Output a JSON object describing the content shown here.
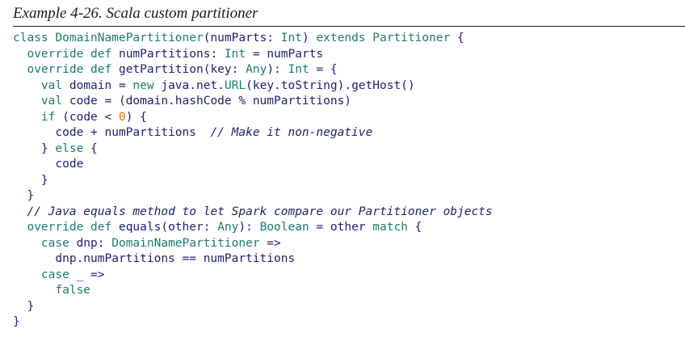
{
  "caption": "Example 4-26. Scala custom partitioner",
  "code_lines": [
    [
      [
        "k",
        "class "
      ],
      [
        "t",
        "DomainNamePartitioner"
      ],
      [
        "p",
        "(numParts: "
      ],
      [
        "t",
        "Int"
      ],
      [
        "p",
        ") "
      ],
      [
        "k",
        "extends "
      ],
      [
        "t",
        "Partitioner"
      ],
      [
        "p",
        " {"
      ]
    ],
    [
      [
        "p",
        "  "
      ],
      [
        "k",
        "override def "
      ],
      [
        "p",
        "numPartitions: "
      ],
      [
        "t",
        "Int"
      ],
      [
        "p",
        " = numParts"
      ]
    ],
    [
      [
        "p",
        "  "
      ],
      [
        "k",
        "override def "
      ],
      [
        "p",
        "getPartition(key: "
      ],
      [
        "t",
        "Any"
      ],
      [
        "p",
        "): "
      ],
      [
        "t",
        "Int"
      ],
      [
        "p",
        " = {"
      ]
    ],
    [
      [
        "p",
        "    "
      ],
      [
        "k",
        "val "
      ],
      [
        "p",
        "domain = "
      ],
      [
        "k",
        "new "
      ],
      [
        "p",
        "java.net."
      ],
      [
        "t",
        "URL"
      ],
      [
        "p",
        "(key.toString).getHost()"
      ]
    ],
    [
      [
        "p",
        "    "
      ],
      [
        "k",
        "val "
      ],
      [
        "p",
        "code = (domain.hashCode % numPartitions)"
      ]
    ],
    [
      [
        "p",
        "    "
      ],
      [
        "k",
        "if "
      ],
      [
        "p",
        "(code < "
      ],
      [
        "n",
        "0"
      ],
      [
        "p",
        ") {"
      ]
    ],
    [
      [
        "p",
        "      code + numPartitions  "
      ],
      [
        "c",
        "// Make it non-negative"
      ]
    ],
    [
      [
        "p",
        "    } "
      ],
      [
        "k",
        "else "
      ],
      [
        "p",
        "{"
      ]
    ],
    [
      [
        "p",
        "      code"
      ]
    ],
    [
      [
        "p",
        "    }"
      ]
    ],
    [
      [
        "p",
        "  }"
      ]
    ],
    [
      [
        "p",
        "  "
      ],
      [
        "c",
        "// Java equals method to let Spark compare our Partitioner objects"
      ]
    ],
    [
      [
        "p",
        "  "
      ],
      [
        "k",
        "override def "
      ],
      [
        "p",
        "equals(other: "
      ],
      [
        "t",
        "Any"
      ],
      [
        "p",
        "): "
      ],
      [
        "t",
        "Boolean"
      ],
      [
        "p",
        " = other "
      ],
      [
        "k",
        "match "
      ],
      [
        "p",
        "{"
      ]
    ],
    [
      [
        "p",
        "    "
      ],
      [
        "k",
        "case "
      ],
      [
        "p",
        "dnp: "
      ],
      [
        "t",
        "DomainNamePartitioner"
      ],
      [
        "p",
        " =>"
      ]
    ],
    [
      [
        "p",
        "      dnp.numPartitions == numPartitions"
      ]
    ],
    [
      [
        "p",
        "    "
      ],
      [
        "k",
        "case "
      ],
      [
        "p",
        "_ =>"
      ]
    ],
    [
      [
        "p",
        "      "
      ],
      [
        "k",
        "false"
      ]
    ],
    [
      [
        "p",
        "  }"
      ]
    ],
    [
      [
        "p",
        "}"
      ]
    ]
  ],
  "colors": {
    "keyword": "#1e7a6e",
    "type": "#1e7a6e",
    "plain": "#1e1e6e",
    "comment": "#222266",
    "number": "#e0700f"
  }
}
